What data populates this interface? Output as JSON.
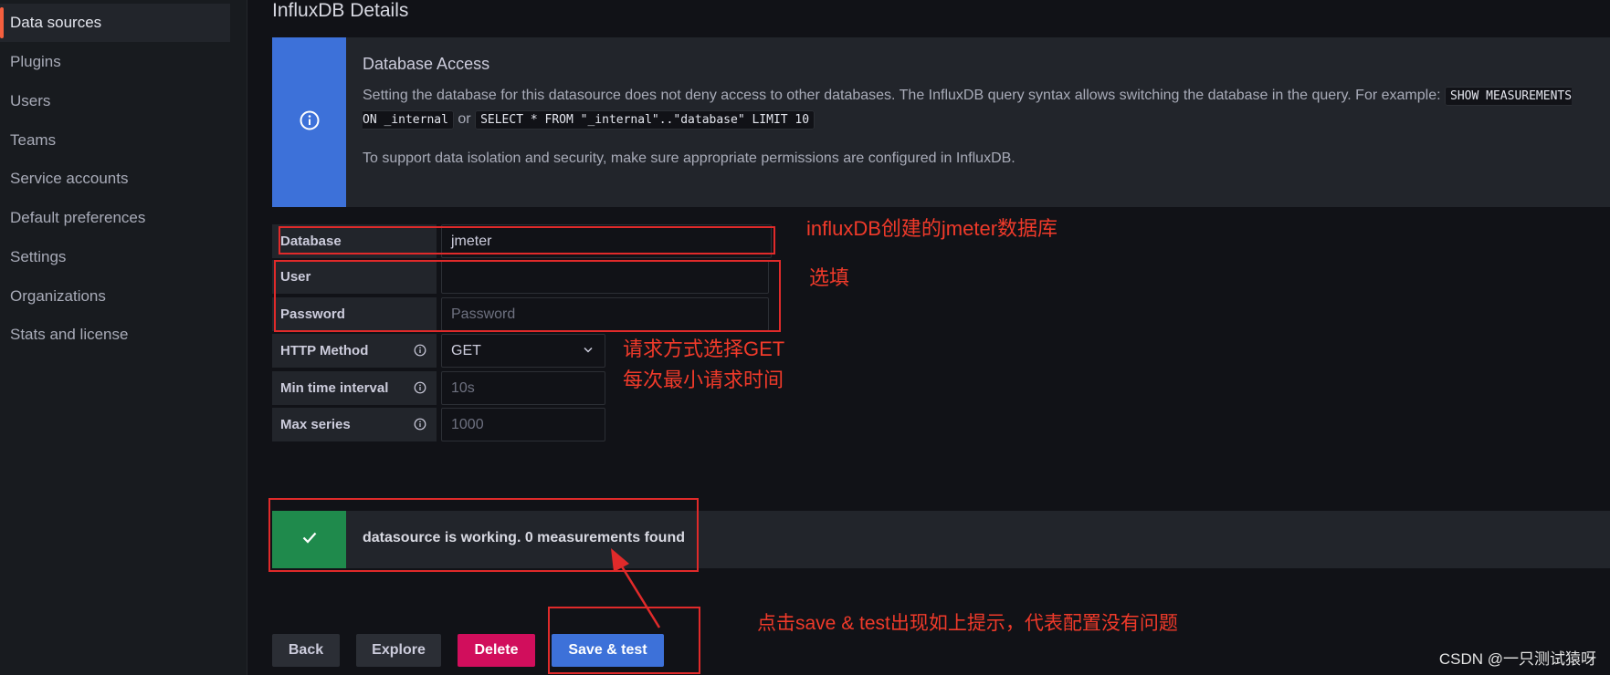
{
  "sidebar": {
    "items": [
      {
        "label": "Data sources",
        "active": true
      },
      {
        "label": "Plugins"
      },
      {
        "label": "Users"
      },
      {
        "label": "Teams"
      },
      {
        "label": "Service accounts"
      },
      {
        "label": "Default preferences"
      },
      {
        "label": "Settings"
      },
      {
        "label": "Organizations"
      },
      {
        "label": "Stats and license"
      }
    ]
  },
  "page": {
    "title": "InfluxDB Details"
  },
  "info": {
    "heading": "Database Access",
    "text_before": "Setting the database for this datasource does not deny access to other databases. The InfluxDB query syntax allows switching the database in the query. For example:",
    "code1": "SHOW MEASUREMENTS ON _internal",
    "or": "or",
    "code2": "SELECT * FROM \"_internal\"..\"database\" LIMIT 10",
    "text2": "To support data isolation and security, make sure appropriate permissions are configured in InfluxDB."
  },
  "form": {
    "database": {
      "label": "Database",
      "value": "jmeter"
    },
    "user": {
      "label": "User",
      "value": ""
    },
    "password": {
      "label": "Password",
      "placeholder": "Password"
    },
    "http_method": {
      "label": "HTTP Method",
      "value": "GET"
    },
    "min_time_interval": {
      "label": "Min time interval",
      "placeholder": "10s"
    },
    "max_series": {
      "label": "Max series",
      "placeholder": "1000"
    }
  },
  "alert": {
    "text": "datasource is working. 0 measurements found"
  },
  "buttons": {
    "back": "Back",
    "explore": "Explore",
    "delete": "Delete",
    "save": "Save & test"
  },
  "annotations": {
    "database": "influxDB创建的jmeter数据库",
    "optional": "选填",
    "method_line1": "请求方式选择GET",
    "method_line2": "每次最小请求时间",
    "save": "点击save & test出现如上提示，代表配置没有问题"
  },
  "watermark": "CSDN @一只测试猿呀",
  "colors": {
    "primary": "#3d71d9",
    "success": "#1f8a4c",
    "danger": "#d10e5c",
    "annotation": "#e02a2a",
    "active_indicator": "#f55f3e"
  }
}
